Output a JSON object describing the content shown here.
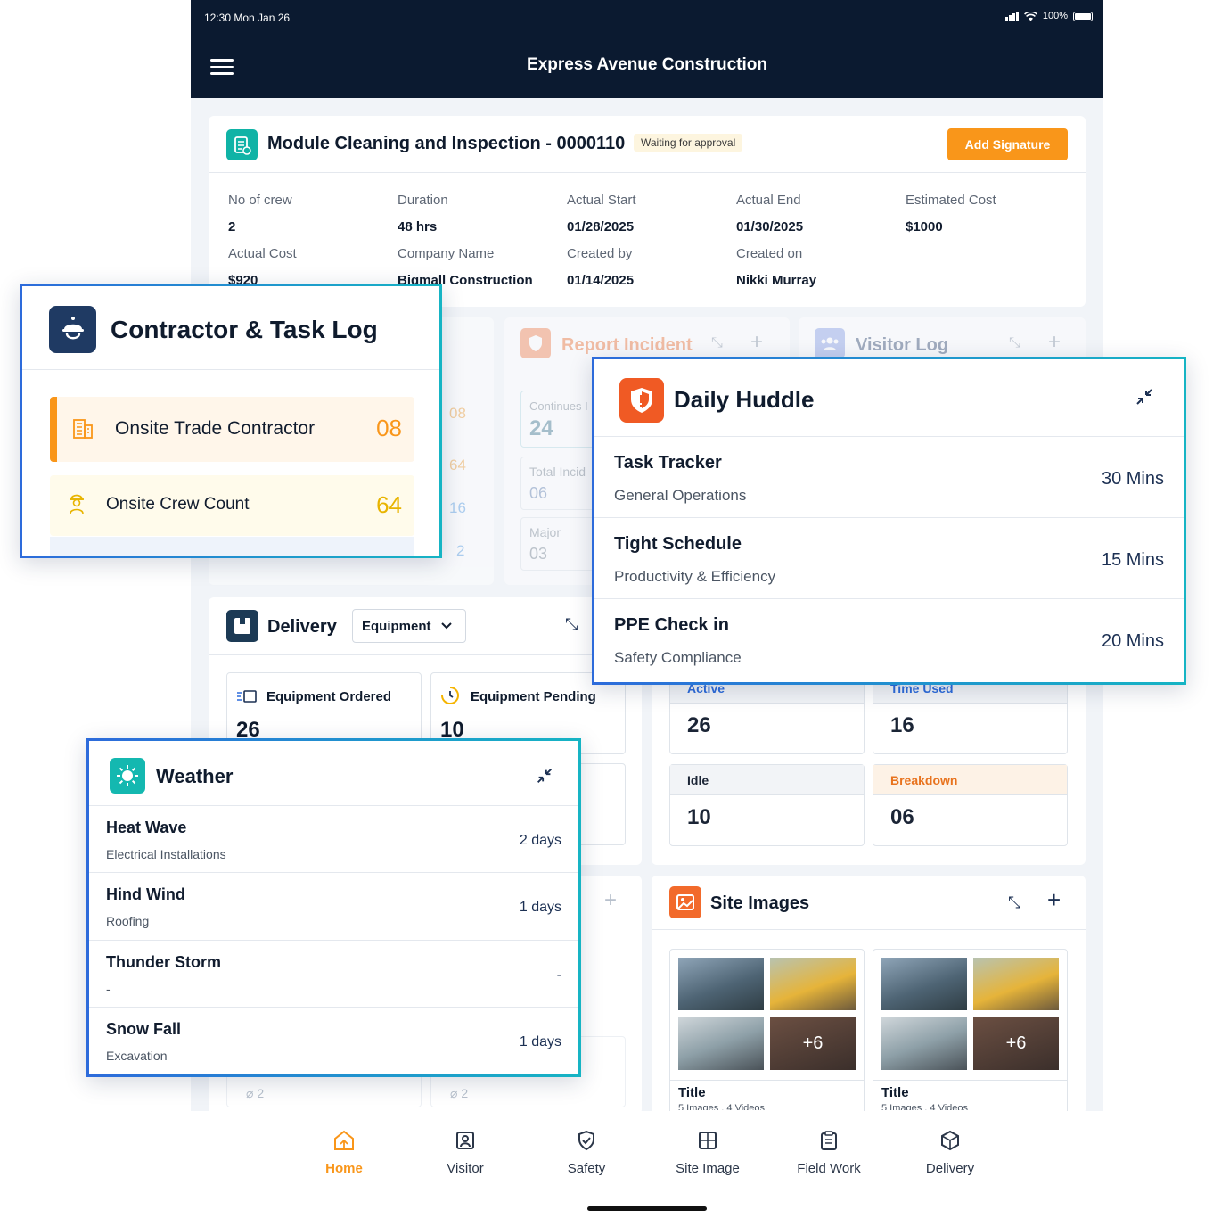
{
  "status_bar": {
    "time": "12:30 Mon Jan 26",
    "battery": "100%"
  },
  "app": {
    "title": "Express Avenue Construction"
  },
  "module": {
    "title": "Module Cleaning and Inspection -  0000110",
    "badge": "Waiting for approval",
    "action": "Add Signature",
    "fields": [
      {
        "label": "No of crew",
        "value": "2"
      },
      {
        "label": "Duration",
        "value": "48 hrs"
      },
      {
        "label": "Actual Start",
        "value": "01/28/2025"
      },
      {
        "label": "Actual End",
        "value": "01/30/2025"
      },
      {
        "label": "Estimated Cost",
        "value": "$1000"
      },
      {
        "label": "Actual Cost",
        "value": "$920"
      },
      {
        "label": "Company Name",
        "value": "Bigmall Construction"
      },
      {
        "label": "Created by",
        "value": "01/14/2025"
      },
      {
        "label": "Created on",
        "value": "Nikki Murray"
      }
    ]
  },
  "report_incident": {
    "title": "Report Incident",
    "stats": [
      {
        "label": "Continues I",
        "value": "24"
      },
      {
        "label": "Total Incid",
        "value": "06"
      },
      {
        "label": "Major",
        "value": "03"
      }
    ]
  },
  "visitor_log": {
    "title": "Visitor Log"
  },
  "left_faded_values": [
    "08",
    "64",
    "16",
    "2"
  ],
  "delivery": {
    "title": "Delivery",
    "dropdown": "Equipment",
    "stats": [
      {
        "label": "Equipment Ordered",
        "value": "26"
      },
      {
        "label": "Equipment Pending",
        "value": "10"
      }
    ]
  },
  "equipment": {
    "stats": [
      {
        "label": "Active",
        "value": "26"
      },
      {
        "label": "Time Used",
        "value": "16"
      },
      {
        "label": "Idle",
        "value": "10"
      },
      {
        "label": "Breakdown",
        "value": "06"
      }
    ]
  },
  "site_images": {
    "title": "Site Images",
    "albums": [
      {
        "title": "Title",
        "meta": "5 Images , 4 Videos",
        "more": "+6"
      },
      {
        "title": "Title",
        "meta": "5 Images , 4 Videos",
        "more": "+6"
      }
    ]
  },
  "attachments": [
    "2",
    "2"
  ],
  "contractor_log": {
    "title": "Contractor & Task Log",
    "items": [
      {
        "label": "Onsite Trade Contractor",
        "value": "08"
      },
      {
        "label": "Onsite Crew Count",
        "value": "64"
      }
    ]
  },
  "daily_huddle": {
    "title": "Daily Huddle",
    "items": [
      {
        "title": "Task Tracker",
        "subtitle": "General Operations",
        "duration": "30 Mins"
      },
      {
        "title": "Tight Schedule",
        "subtitle": "Productivity & Efficiency",
        "duration": "15 Mins"
      },
      {
        "title": "PPE Check in",
        "subtitle": "Safety Compliance",
        "duration": "20 Mins"
      }
    ]
  },
  "weather": {
    "title": "Weather",
    "items": [
      {
        "title": "Heat Wave",
        "subtitle": "Electrical Installations",
        "duration": "2 days"
      },
      {
        "title": "Hind Wind",
        "subtitle": "Roofing",
        "duration": "1 days"
      },
      {
        "title": "Thunder Storm",
        "subtitle": "-",
        "duration": "-"
      },
      {
        "title": "Snow Fall",
        "subtitle": "Excavation",
        "duration": "1 days"
      }
    ]
  },
  "bottom_nav": [
    {
      "label": "Home",
      "icon": "home-icon",
      "active": true
    },
    {
      "label": "Visitor",
      "icon": "visitor-icon"
    },
    {
      "label": "Safety",
      "icon": "shield-icon"
    },
    {
      "label": "Site Image",
      "icon": "image-grid-icon"
    },
    {
      "label": "Field Work",
      "icon": "clipboard-icon"
    },
    {
      "label": "Delivery",
      "icon": "package-icon"
    }
  ],
  "colors": {
    "navy": "#0b1a30",
    "accent_orange": "#f9961a",
    "teal": "#16b4c4",
    "blue": "#2d6bdb"
  }
}
